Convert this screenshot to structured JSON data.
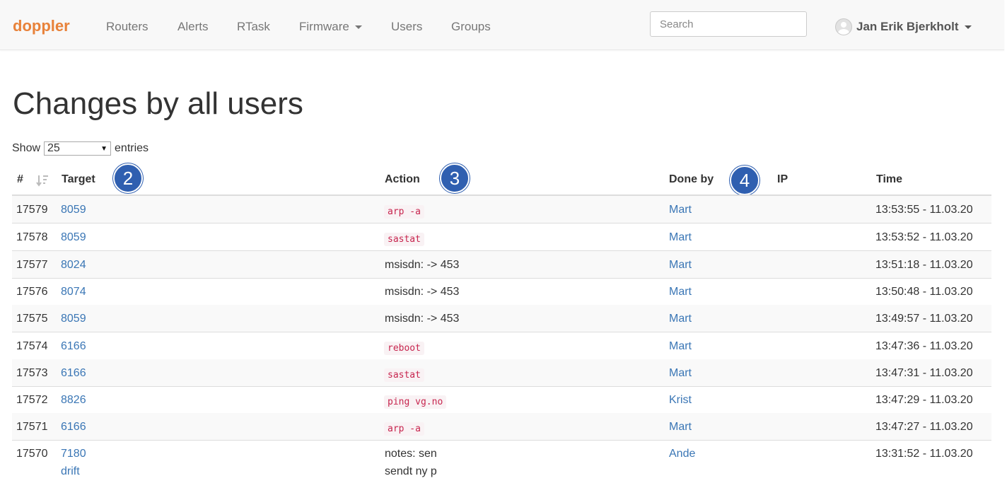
{
  "navbar": {
    "brand": "doppler",
    "items": [
      "Routers",
      "Alerts",
      "RTask",
      "Firmware",
      "Users",
      "Groups"
    ],
    "search_placeholder": "Search",
    "user_name": "Jan Erik Bjerkholt"
  },
  "page": {
    "title": "Changes by all users",
    "show_label": "Show",
    "entries_value": "25",
    "entries_label": "entries"
  },
  "table": {
    "headers": {
      "id": "#",
      "target": "Target",
      "action": "Action",
      "done_by": "Done by",
      "ip": "IP",
      "time": "Time"
    },
    "badges": [
      "2",
      "3",
      "4"
    ],
    "rows": [
      {
        "id": "17579",
        "target": "8059",
        "action": "arp -a",
        "done_by": "Mart",
        "time": "13:53:55 - 11.03.20"
      },
      {
        "id": "17578",
        "target": "8059",
        "action": "sastat",
        "done_by": "Mart",
        "time": "13:53:52 - 11.03.20"
      },
      {
        "id": "17577",
        "target": "8024",
        "action": "msisdn: -> 453",
        "done_by": "Mart",
        "time": "13:51:18 - 11.03.20"
      },
      {
        "id": "17576",
        "target": "8074",
        "action": "msisdn: -> 453",
        "done_by": "Mart",
        "time": "13:50:48 - 11.03.20"
      },
      {
        "id": "17575",
        "target": "8059",
        "action": "msisdn: -> 453",
        "done_by": "Mart",
        "time": "13:49:57 - 11.03.20"
      },
      {
        "id": "17574",
        "target": "6166",
        "action": "reboot",
        "done_by": "Mart",
        "time": "13:47:36 - 11.03.20"
      },
      {
        "id": "17573",
        "target": "6166",
        "action": "sastat",
        "done_by": "Mart",
        "time": "13:47:31 - 11.03.20"
      },
      {
        "id": "17572",
        "target": "8826",
        "action": "ping vg.no",
        "done_by": "Krist",
        "time": "13:47:29 - 11.03.20"
      },
      {
        "id": "17571",
        "target": "6166",
        "action": "arp -a",
        "done_by": "Mart",
        "time": "13:47:27 - 11.03.20"
      },
      {
        "id": "17570",
        "target": "7180",
        "target_line2": "drift",
        "action": "notes: sen",
        "action_line2": "sendt ny p",
        "done_by": "Ande",
        "time": "13:31:52 - 11.03.20"
      }
    ]
  }
}
